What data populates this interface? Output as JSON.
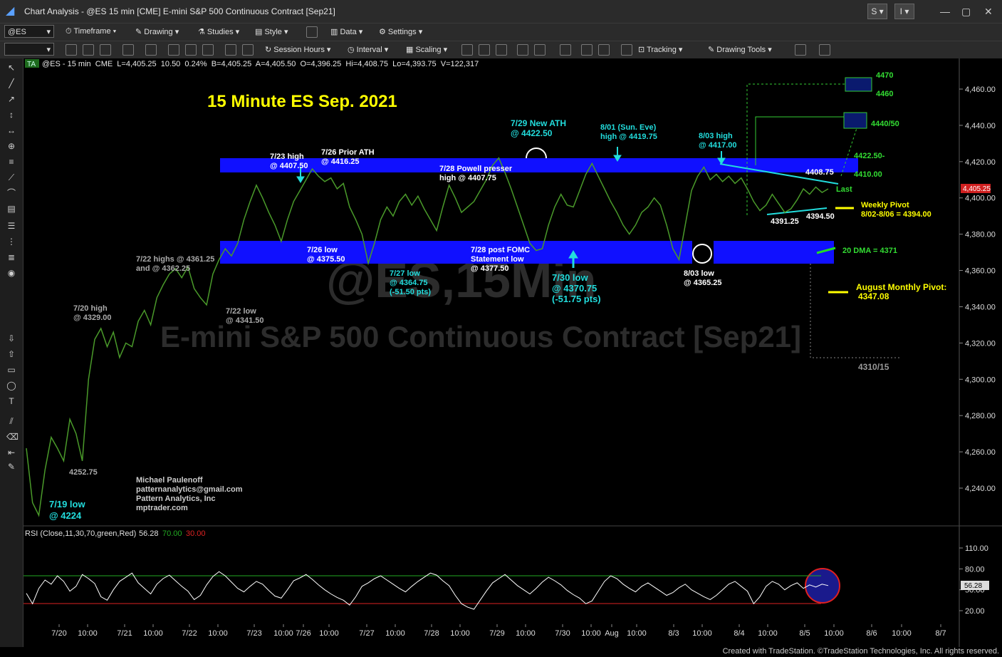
{
  "window": {
    "title": "Chart Analysis - @ES 15 min [CME] E-mini S&P 500 Continuous Contract [Sep21]",
    "buttons": [
      "S",
      "I"
    ]
  },
  "toolbar1": {
    "symbol": "@ES",
    "items": [
      "Timeframe",
      "Drawing",
      "Studies",
      "Style",
      "Data",
      "Settings"
    ]
  },
  "toolbar2": {
    "items": [
      "Session Hours",
      "Interval",
      "Scaling",
      "Tracking",
      "Drawing Tools"
    ]
  },
  "header": {
    "badge": "TA",
    "text": "@ES - 15 min  CME  L=4,405.25  10.50  0.24%  B=4,405.25  A=4,405.50  O=4,396.25  Hi=4,408.75  Lo=4,393.75  V=122,317"
  },
  "watermark": {
    "symbol": "@ES,15Min",
    "name": "E-mini S&P 500 Continuous Contract [Sep21]"
  },
  "footer": "Created with TradeStation. ©TradeStation Technologies, Inc. All rights reserved.",
  "chart_data": [
    {
      "type": "line",
      "title": "15 Minute ES Sep. 2021",
      "ylim": [
        4210,
        4475
      ],
      "yticks": [
        4240,
        4260,
        4280,
        4300,
        4320,
        4340,
        4360,
        4380,
        4400,
        4420,
        4440,
        4460
      ],
      "ytick_labels": [
        "4,240.00",
        "4,260.00",
        "4,280.00",
        "4,300.00",
        "4,320.00",
        "4,340.00",
        "4,360.00",
        "4,380.00",
        "4,400.00",
        "4,420.00",
        "4,440.00",
        "4,460.00"
      ],
      "x_labels": [
        "7/20",
        "10:00",
        "7/21",
        "10:00",
        "7/22",
        "10:00",
        "7/23",
        "10:00",
        "7/26",
        "10:00",
        "7/27",
        "10:00",
        "7/28",
        "10:00",
        "7/29",
        "10:00",
        "7/30",
        "10:00",
        "Aug",
        "10:00",
        "8/3",
        "10:00",
        "8/4",
        "10:00",
        "8/5",
        "10:00",
        "8/6",
        "10:00",
        "8/7"
      ],
      "last_label": "4,405.25",
      "series": [
        {
          "values": [
            4262,
            4232,
            4225,
            4250,
            4268,
            4262,
            4255,
            4278,
            4270,
            4255,
            4300,
            4322,
            4328,
            4318,
            4326,
            4312,
            4320,
            4318,
            4332,
            4338,
            4330,
            4345,
            4352,
            4358,
            4361,
            4356,
            4362,
            4350,
            4345,
            4341,
            4358,
            4366,
            4372,
            4368,
            4375,
            4388,
            4398,
            4407,
            4400,
            4392,
            4385,
            4376,
            4388,
            4398,
            4404,
            4410,
            4416,
            4412,
            4409,
            4411,
            4405,
            4408,
            4395,
            4388,
            4380,
            4364,
            4375,
            4388,
            4395,
            4390,
            4398,
            4402,
            4396,
            4401,
            4394,
            4388,
            4382,
            4395,
            4407,
            4400,
            4392,
            4395,
            4398,
            4404,
            4410,
            4418,
            4422,
            4414,
            4405,
            4395,
            4385,
            4375,
            4371,
            4372,
            4385,
            4395,
            4402,
            4396,
            4395,
            4404,
            4413,
            4419,
            4412,
            4405,
            4398,
            4392,
            4385,
            4380,
            4385,
            4392,
            4395,
            4400,
            4396,
            4385,
            4372,
            4366,
            4385,
            4404,
            4412,
            4417,
            4410,
            4413,
            4409,
            4412,
            4408,
            4411,
            4405,
            4398,
            4393,
            4396,
            4402,
            4397,
            4392,
            4394,
            4399,
            4405,
            4402,
            4406,
            4403,
            4405
          ]
        }
      ],
      "annotations": [
        "7/19 low",
        "@ 4224",
        "4252.75",
        "7/20 high",
        "@ 4329.00",
        "7/22 highs  @ 4361.25",
        "and @ 4362.25",
        "7/22 low",
        "@ 4341.50",
        "7/23 high",
        "@ 4407.50",
        "7/26 Prior ATH",
        "@ 4416.25",
        "7/26 low",
        "@ 4375.50",
        "7/27 low",
        "@ 4364.75",
        "(-51.50 pts)",
        "7/28 Powell presser",
        "high @ 4407.75",
        "7/28 post FOMC",
        "Statement low",
        "@ 4377.50",
        "7/29 New ATH",
        "@ 4422.50",
        "7/30 low",
        "@ 4370.75",
        "(-51.75 pts)",
        "8/01 (Sun. Eve)",
        "high @ 4419.75",
        "8/03 high",
        "@ 4417.00",
        "8/03 low",
        "@ 4365.25",
        "4408.75",
        "4391.25",
        "4394.50",
        "4470",
        "4460",
        "4440/50",
        "4422.50-",
        "4410.00",
        "Last",
        "Weekly Pivot",
        "8/02-8/06 = 4394.00",
        "20 DMA = 4371",
        "August Monthly Pivot:",
        "4347.08",
        "4310/15",
        "Michael Paulenoff",
        "patternanalytics@gmail.com",
        "Pattern Analytics, Inc",
        "mptrader.com"
      ]
    },
    {
      "type": "line",
      "title": "RSI (Close,11,30,70,green,Red)",
      "legend": [
        "56.28",
        "70.00",
        "30.00"
      ],
      "ylim": [
        0,
        120
      ],
      "yticks": [
        20,
        50,
        80,
        110
      ],
      "ytick_labels": [
        "20.00",
        "50.00",
        "80.00",
        "110.00"
      ],
      "thresholds": [
        70,
        30
      ],
      "last_label": "56.28",
      "series": [
        {
          "values": [
            45,
            30,
            52,
            64,
            58,
            70,
            62,
            48,
            55,
            72,
            66,
            59,
            40,
            35,
            50,
            62,
            68,
            74,
            60,
            52,
            44,
            58,
            66,
            71,
            63,
            55,
            48,
            36,
            42,
            57,
            69,
            76,
            70,
            61,
            52,
            47,
            55,
            62,
            58,
            49,
            41,
            38,
            50,
            63,
            67,
            72,
            65,
            57,
            50,
            44,
            39,
            35,
            28,
            40,
            55,
            60,
            66,
            70,
            64,
            58,
            52,
            47,
            55,
            62,
            68,
            74,
            71,
            63,
            56,
            42,
            30,
            25,
            22,
            35,
            48,
            60,
            66,
            72,
            64,
            56,
            50,
            44,
            52,
            61,
            68,
            63,
            57,
            49,
            43,
            38,
            30,
            34,
            48,
            62,
            70,
            66,
            58,
            52,
            47,
            55,
            60,
            54,
            48,
            42,
            46,
            53,
            58,
            50,
            45,
            40,
            36,
            42,
            50,
            58,
            62,
            55,
            48,
            30,
            40,
            55,
            62,
            58,
            50,
            56,
            60,
            52,
            57,
            54,
            58,
            56
          ]
        }
      ],
      "color_accent": "#1a1a8c"
    }
  ]
}
